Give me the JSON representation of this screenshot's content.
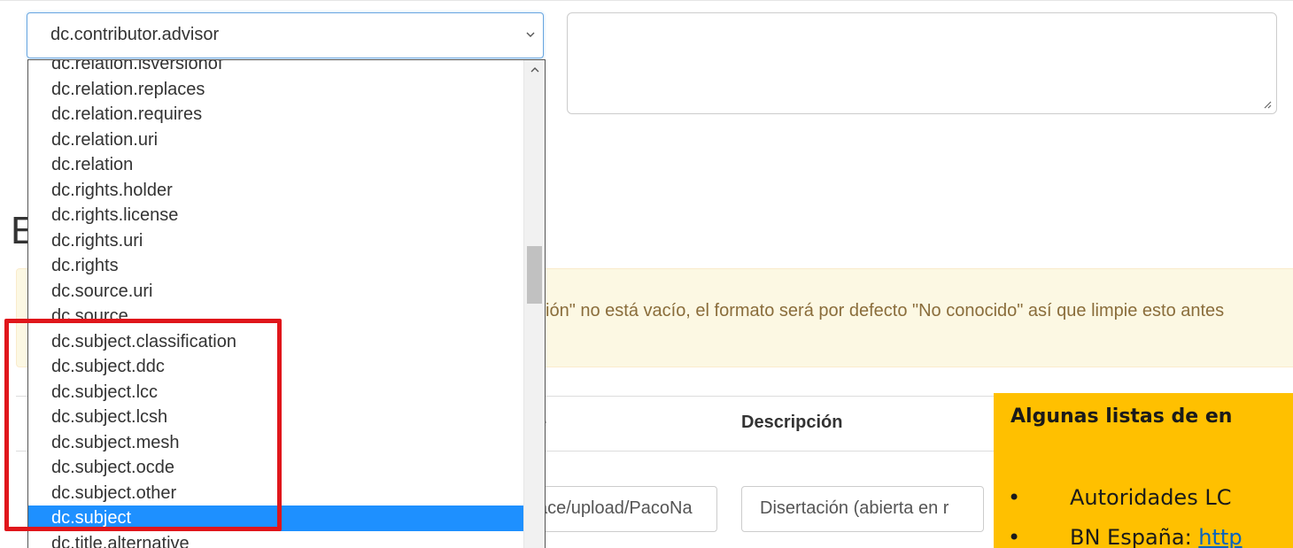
{
  "select": {
    "value": "dc.contributor.advisor"
  },
  "dropdown": {
    "items": [
      "dc.relation.isversionof",
      "dc.relation.replaces",
      "dc.relation.requires",
      "dc.relation.uri",
      "dc.relation",
      "dc.rights.holder",
      "dc.rights.license",
      "dc.rights.uri",
      "dc.rights",
      "dc.source.uri",
      "dc.source",
      "dc.subject.classification",
      "dc.subject.ddc",
      "dc.subject.lcc",
      "dc.subject.lcsh",
      "dc.subject.mesh",
      "dc.subject.ocde",
      "dc.subject.other",
      "dc.subject",
      "dc.title.alternative"
    ],
    "selected": "dc.subject"
  },
  "page": {
    "heading_partial": "E",
    "alert_text": "ción\" no está vacío, el formato será por defecto \"No conocido\" así que limpie esto antes",
    "table_header_partial": "e",
    "table_header_description": "Descripción",
    "row_url_value": "ace/upload/PacoNa",
    "row_description_value": "Disertación (abierta en r"
  },
  "slide": {
    "title": "Algunas listas de en",
    "bullets": [
      {
        "marker": "•",
        "text": "Autoridades LC",
        "link": ""
      },
      {
        "marker": "•",
        "text": "BN España: ",
        "link": "http"
      }
    ]
  },
  "colors": {
    "selected_item": "#1e90ff",
    "highlight_border": "#e0161b",
    "slide_background": "#ffc000",
    "alert_background": "#fcf8e3"
  }
}
